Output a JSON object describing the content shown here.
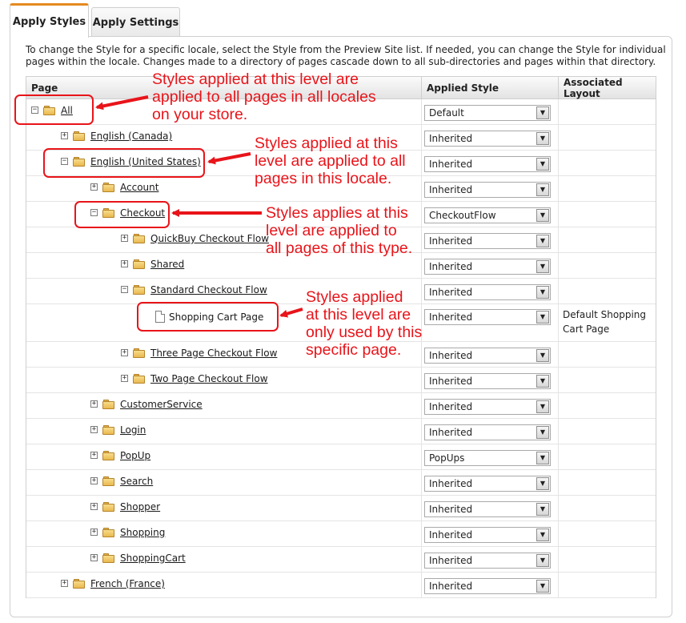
{
  "tabs": [
    {
      "label": "Apply Styles",
      "active": true
    },
    {
      "label": "Apply Settings",
      "active": false
    }
  ],
  "intro": "To change the Style for a specific locale, select the Style from the Preview Site list. If needed, you can change the Style for individual pages within the locale. Changes made to a directory of pages cascade down to all sub-directories and pages within that directory.",
  "columns": {
    "page": "Page",
    "style": "Applied Style",
    "layout": "Associated Layout"
  },
  "rows": [
    {
      "name": "All",
      "style": "Default",
      "layout": ""
    },
    {
      "name": "English (Canada)",
      "style": "Inherited",
      "layout": ""
    },
    {
      "name": "English (United States)",
      "style": "Inherited",
      "layout": ""
    },
    {
      "name": "Account",
      "style": "Inherited",
      "layout": ""
    },
    {
      "name": "Checkout",
      "style": "CheckoutFlow",
      "layout": ""
    },
    {
      "name": "QuickBuy Checkout Flow",
      "style": "Inherited",
      "layout": ""
    },
    {
      "name": "Shared",
      "style": "Inherited",
      "layout": ""
    },
    {
      "name": "Standard Checkout Flow",
      "style": "Inherited",
      "layout": ""
    },
    {
      "name": "Shopping Cart Page",
      "style": "Inherited",
      "layout": "Default Shopping Cart Page"
    },
    {
      "name": "Three Page Checkout Flow",
      "style": "Inherited",
      "layout": ""
    },
    {
      "name": "Two Page Checkout Flow",
      "style": "Inherited",
      "layout": ""
    },
    {
      "name": "CustomerService",
      "style": "Inherited",
      "layout": ""
    },
    {
      "name": "Login",
      "style": "Inherited",
      "layout": ""
    },
    {
      "name": "PopUp",
      "style": "PopUps",
      "layout": ""
    },
    {
      "name": "Search",
      "style": "Inherited",
      "layout": ""
    },
    {
      "name": "Shopper",
      "style": "Inherited",
      "layout": ""
    },
    {
      "name": "Shopping",
      "style": "Inherited",
      "layout": ""
    },
    {
      "name": "ShoppingCart",
      "style": "Inherited",
      "layout": ""
    },
    {
      "name": "French (France)",
      "style": "Inherited",
      "layout": ""
    }
  ],
  "annotations": [
    [
      "Styles applied at this level are",
      "applied to all pages in all locales",
      "on your store."
    ],
    [
      "Styles applied at this",
      "level are applied to all",
      "pages in this locale."
    ],
    [
      "Styles applies at this",
      "level are applied to",
      "all pages of this type."
    ],
    [
      "Styles applied",
      "at this level are",
      "only used by this",
      "specific page."
    ]
  ],
  "colors": {
    "annotation": "#e8141a",
    "active_tab_accent": "#e58a1f"
  }
}
